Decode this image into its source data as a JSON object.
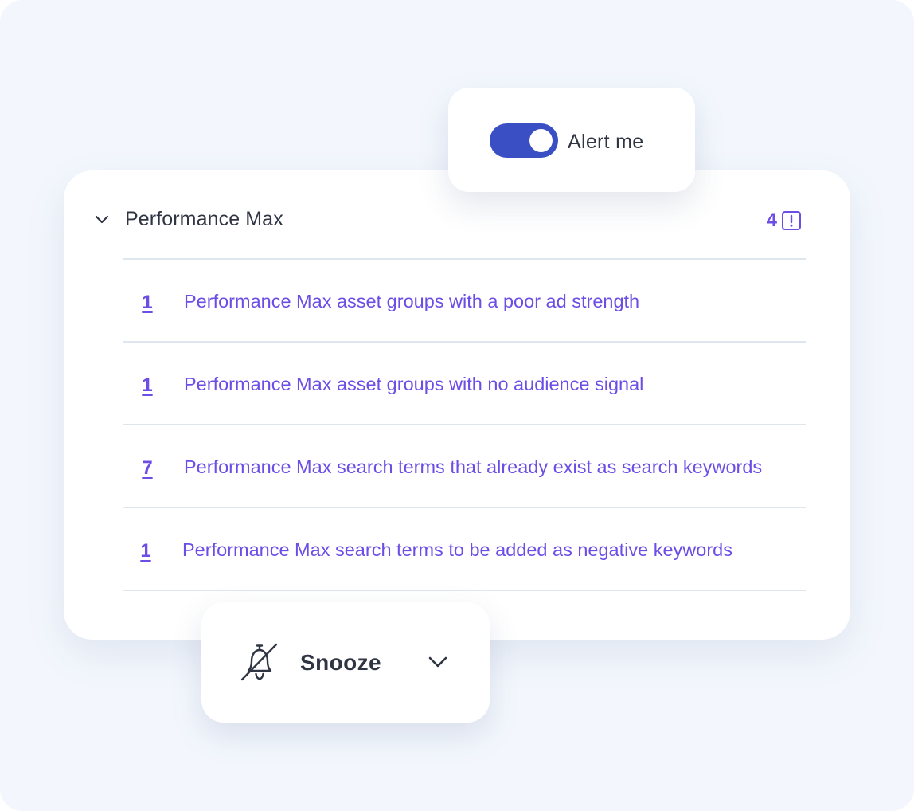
{
  "alert": {
    "label": "Alert me",
    "enabled": true,
    "toggle_color": "#3a4fc3"
  },
  "group": {
    "title": "Performance Max",
    "count": "4",
    "expanded": true,
    "icon": "exclamation-square-icon",
    "accent_color": "#6c4de6"
  },
  "items": [
    {
      "count": "1",
      "label": "Performance Max asset groups with a poor ad strength"
    },
    {
      "count": "1",
      "label": "Performance Max asset groups with no audience signal"
    },
    {
      "count": "7",
      "label": "Performance Max search terms that already exist as search keywords"
    },
    {
      "count": "1",
      "label": "Performance Max search terms to be added as negative keywords"
    }
  ],
  "snooze": {
    "label": "Snooze",
    "icon": "bell-off-icon",
    "dropdown_icon": "chevron-down-icon"
  }
}
